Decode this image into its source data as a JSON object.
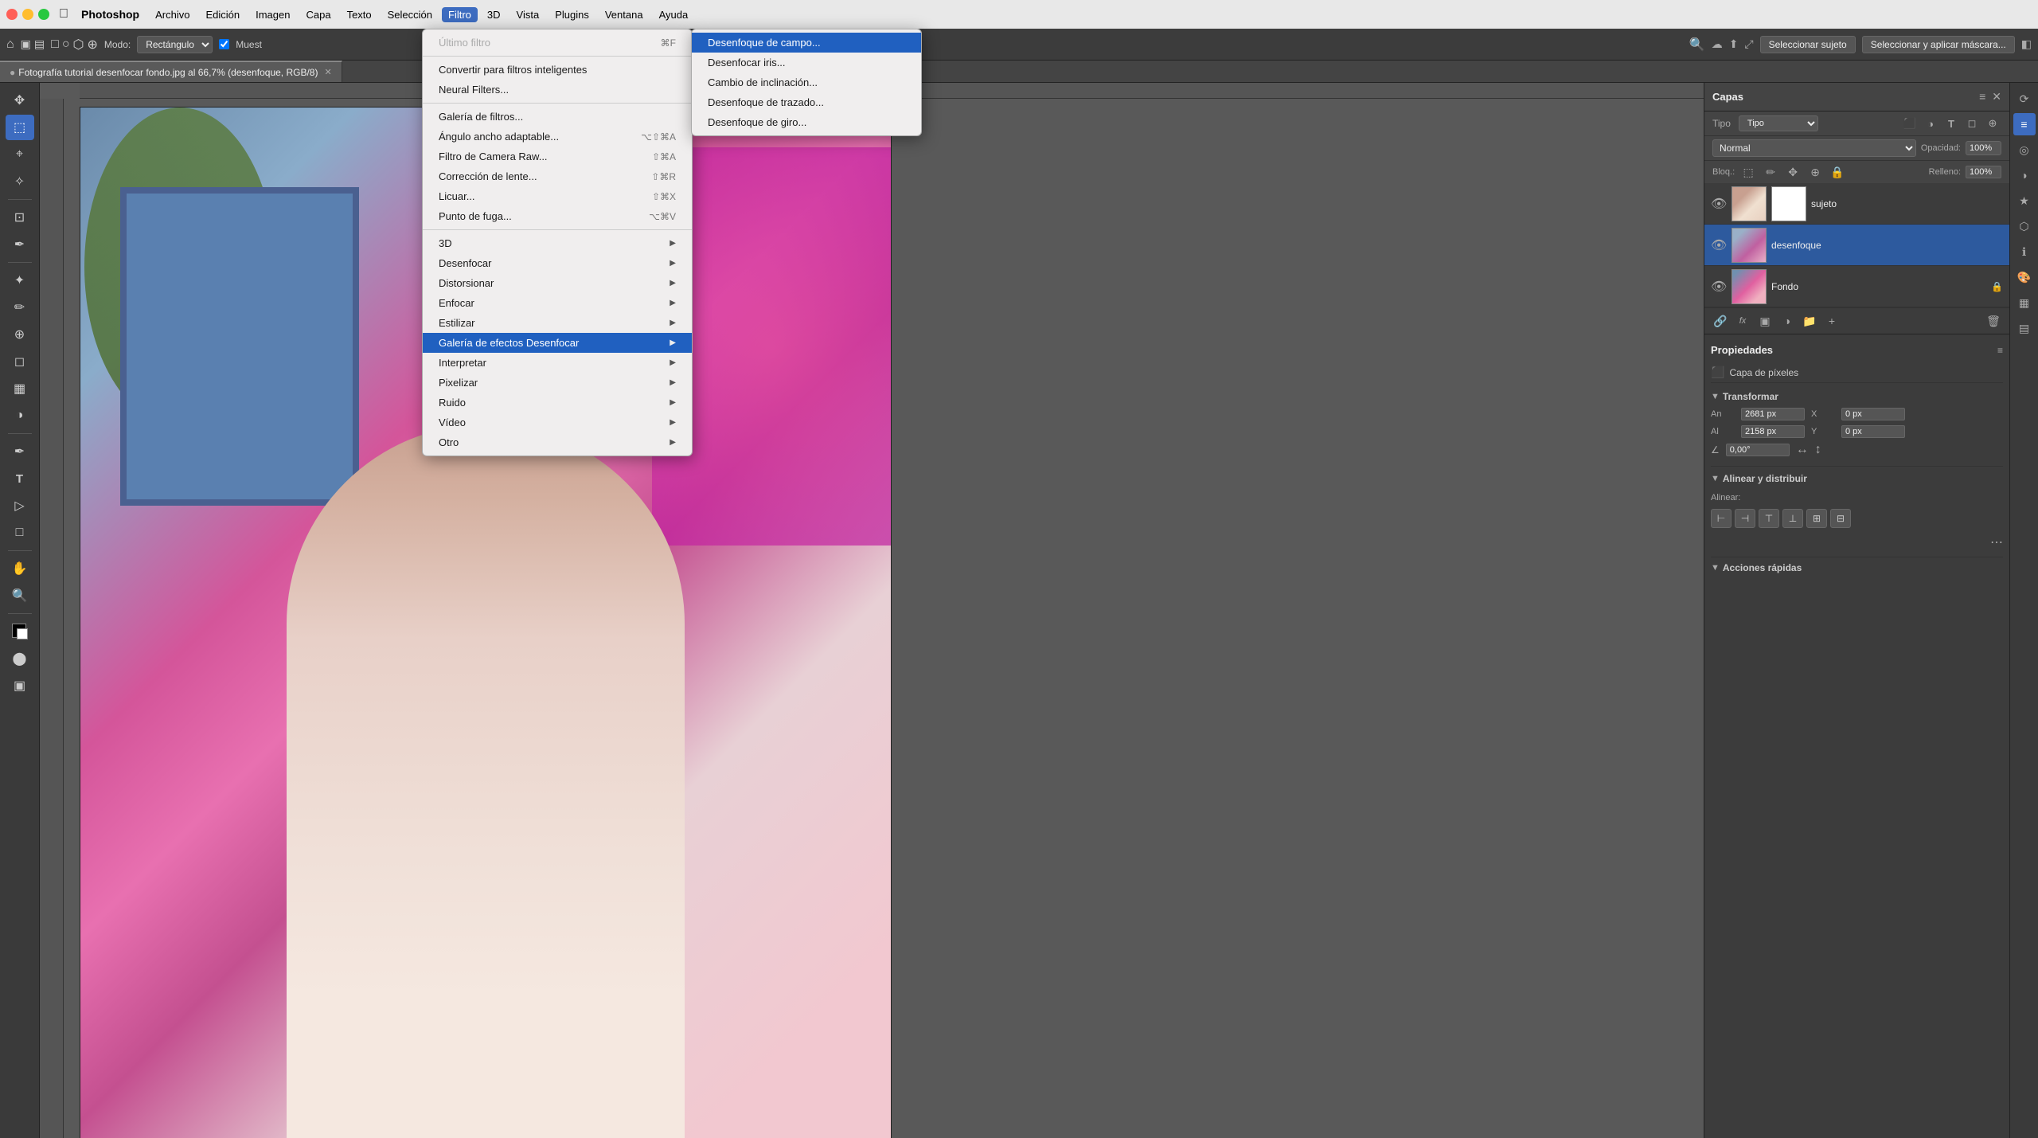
{
  "app": {
    "name": "Photoshop"
  },
  "menubar": {
    "items": [
      {
        "id": "archivo",
        "label": "Archivo"
      },
      {
        "id": "edicion",
        "label": "Edición"
      },
      {
        "id": "imagen",
        "label": "Imagen"
      },
      {
        "id": "capa",
        "label": "Capa"
      },
      {
        "id": "texto",
        "label": "Texto"
      },
      {
        "id": "seleccion",
        "label": "Selección"
      },
      {
        "id": "filtro",
        "label": "Filtro",
        "active": true
      },
      {
        "id": "3d",
        "label": "3D"
      },
      {
        "id": "vista",
        "label": "Vista"
      },
      {
        "id": "plugins",
        "label": "Plugins"
      },
      {
        "id": "ventana",
        "label": "Ventana"
      },
      {
        "id": "ayuda",
        "label": "Ayuda"
      }
    ]
  },
  "options_bar": {
    "mode_label": "Modo:",
    "mode_value": "Rectángulo",
    "muestra_label": "Muest",
    "btn_seleccionar_sujeto": "Seleccionar sujeto",
    "btn_seleccionar_aplicar": "Seleccionar y aplicar máscara..."
  },
  "doc_tab": {
    "title": "Fotografía tutorial desenfocar fondo.jpg al 66,7% (desenfoque, RGB/8)",
    "modified": true
  },
  "filtro_menu": {
    "ultimo_filtro": {
      "label": "Último filtro",
      "shortcut": "⌘F",
      "disabled": true
    },
    "convertir": {
      "label": "Convertir para filtros inteligentes"
    },
    "neural": {
      "label": "Neural Filters..."
    },
    "galeria_filtros": {
      "label": "Galería de filtros..."
    },
    "angulo_ancho": {
      "label": "Ángulo ancho adaptable...",
      "shortcut": "⌥⇧⌘A"
    },
    "camera_raw": {
      "label": "Filtro de Camera Raw...",
      "shortcut": "⇧⌘A"
    },
    "correccion": {
      "label": "Corrección de lente...",
      "shortcut": "⇧⌘R"
    },
    "licuar": {
      "label": "Licuar...",
      "shortcut": "⇧⌘X"
    },
    "punto_fuga": {
      "label": "Punto de fuga...",
      "shortcut": "⌥⌘V"
    },
    "3d": {
      "label": "3D"
    },
    "desenfocar": {
      "label": "Desenfocar"
    },
    "distorsionar": {
      "label": "Distorsionar"
    },
    "enfocar": {
      "label": "Enfocar"
    },
    "estilizar": {
      "label": "Estilizar"
    },
    "galeria_efectos": {
      "label": "Galería de efectos Desenfocar",
      "highlighted": true
    },
    "interpretar": {
      "label": "Interpretar"
    },
    "pixelizar": {
      "label": "Pixelizar"
    },
    "ruido": {
      "label": "Ruido"
    },
    "video": {
      "label": "Vídeo"
    },
    "otro": {
      "label": "Otro"
    }
  },
  "galeria_submenu": {
    "items": [
      {
        "label": "Desenfoque de campo...",
        "highlighted": true
      },
      {
        "label": "Desenfocar iris..."
      },
      {
        "label": "Cambio de inclinación..."
      },
      {
        "label": "Desenfoque de trazado..."
      },
      {
        "label": "Desenfoque de giro..."
      }
    ]
  },
  "layers_panel": {
    "title": "Capas",
    "filter_label": "Tipo",
    "blend_mode": "Normal",
    "opacity_label": "Opacidad:",
    "opacity_value": "100%",
    "lock_label": "Bloq.:",
    "fill_label": "Relleno:",
    "fill_value": "100%",
    "layers": [
      {
        "name": "sujeto",
        "visible": true,
        "has_mask": true,
        "active": false
      },
      {
        "name": "desenfoque",
        "visible": true,
        "has_mask": false,
        "active": true
      },
      {
        "name": "Fondo",
        "visible": true,
        "has_mask": false,
        "active": false
      }
    ],
    "bottom_tools": [
      "link",
      "fx",
      "mask",
      "adjustment",
      "folder",
      "new",
      "delete"
    ]
  },
  "properties_panel": {
    "title": "Propiedades",
    "layer_type": "Capa de píxeles",
    "transform_section": "Transformar",
    "an_label": "An",
    "an_value": "2681 px",
    "x_label": "X",
    "x_value": "0 px",
    "al_label": "Al",
    "al_value": "2158 px",
    "y_label": "Y",
    "y_value": "0 px",
    "angle_label": "0,00°",
    "alinear_section": "Alinear y distribuir",
    "alinear_label": "Alinear:",
    "quick_actions": "Acciones rápidas"
  }
}
